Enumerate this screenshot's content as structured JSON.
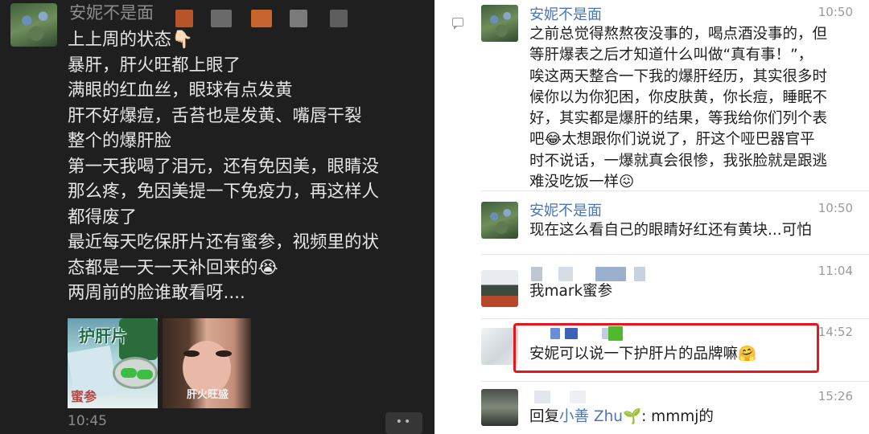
{
  "left_chat": {
    "sender_name": "安妮不是面",
    "lines": [
      "上上周的状态👇🏻",
      "暴肝，肝火旺都上眼了",
      "满眼的红血丝，眼球有点发黄",
      "肝不好爆痘，舌苔也是发黄、嘴唇干裂",
      "整个的爆肝脸",
      "第一天我喝了泪元，还有免因美，眼睛没",
      "那么疼，免因美提一下免疫力，再这样人",
      "都得废了",
      "最近每天吃保肝片还有蜜参，视频里的状",
      "态都是一天一天补回来的😭",
      "两周前的脸谁敢看呀...."
    ],
    "image1_label": "护肝片",
    "image1_label2": "蜜参",
    "image2_caption": "肝火旺盛",
    "time": "10:45",
    "more_icon": "••"
  },
  "right_chat": {
    "messages": [
      {
        "name": "安妮不是面",
        "time": "10:50",
        "lines": [
          "之前总觉得熬熬夜没事的，喝点酒没事的，但",
          "等肝爆表之后才知道什么叫做“真有事！”，",
          "唉这两天整合一下我的爆肝经历，其实很多时",
          "候你以为你犯困，你皮肤黄，你长痘，睡眠不",
          "好，其实都是爆肝的结果，等我给你们列个表",
          "吧😂太想跟你们说说了，肝这个哑巴器官平",
          "时不说话，一爆就真会很惨，我张脸就是跟逃",
          "难没吃饭一样😖"
        ]
      },
      {
        "name": "安妮不是面",
        "time": "10:50",
        "text": "现在这么看自己的眼睛好红还有黄块...可怕"
      },
      {
        "time": "11:04",
        "text": "我mark蜜参"
      },
      {
        "time": "14:52",
        "text": "安妮可以说一下护肝片的品牌嘛🤗"
      },
      {
        "time": "15:26",
        "reply_prefix": "回复",
        "reply_target": "小善 Zhu🌱",
        "reply_text": ": mmmj的"
      }
    ]
  },
  "colors": {
    "left_bg": "#1f1f1f",
    "name_blue": "#4a76b8",
    "highlight_red": "#e8151f"
  }
}
